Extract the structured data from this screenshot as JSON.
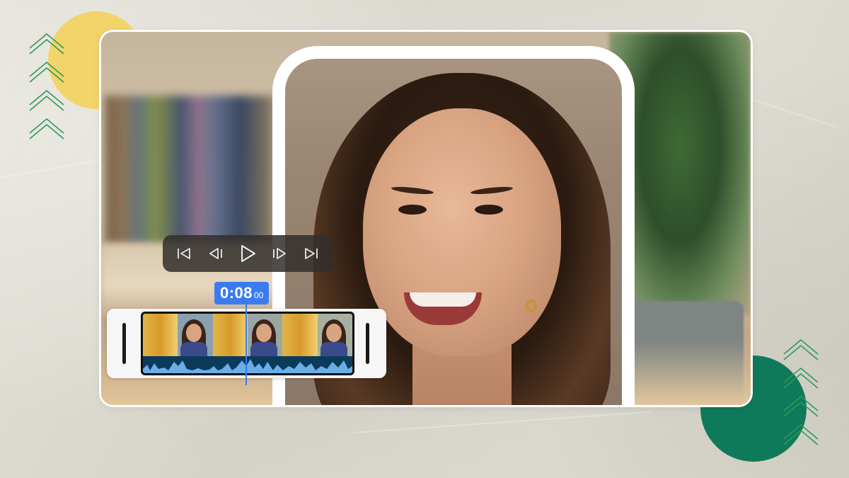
{
  "player": {
    "controls": [
      {
        "id": "skip-start",
        "icon": "skip-to-start-icon"
      },
      {
        "id": "frame-back",
        "icon": "step-back-icon"
      },
      {
        "id": "play",
        "icon": "play-icon"
      },
      {
        "id": "frame-forward",
        "icon": "step-forward-icon"
      },
      {
        "id": "skip-end",
        "icon": "skip-to-end-icon"
      }
    ],
    "timecode": {
      "main": "0:08",
      "frames": "00"
    }
  },
  "colors": {
    "accent": "#3b7bf0",
    "yellow_circle": "#f3d46a",
    "green_circle": "#0f7a5a",
    "chevrons": "#2e9a5a"
  }
}
